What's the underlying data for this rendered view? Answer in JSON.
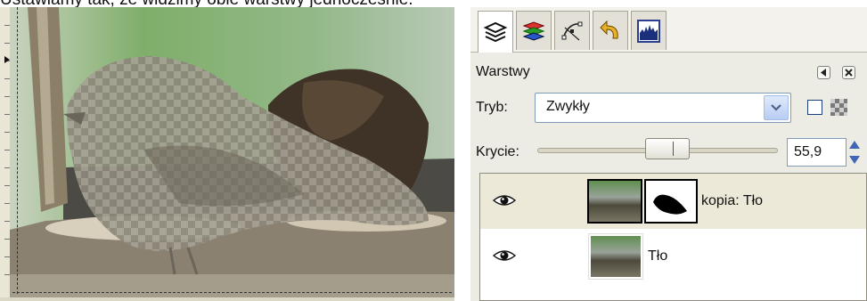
{
  "caption": "Ustawiamy tak, że widzimy obie warstwy jednocześnie.",
  "layers_dialog": {
    "title": "Warstwy",
    "tabs": [
      "layers-tab",
      "channels-tab",
      "paths-tab",
      "undo-history-tab",
      "histogram-tab"
    ],
    "mode_label": "Tryb:",
    "mode_value": "Zwykły",
    "opacity_label": "Krycie:",
    "opacity_value": "55,9",
    "opacity_level": 55.9,
    "layers": [
      {
        "name": "kopia: Tło",
        "visible": true,
        "has_mask": true
      },
      {
        "name": "Tło",
        "visible": true,
        "has_mask": false
      }
    ]
  },
  "colors": {
    "accent_blue": "#1f5fbf",
    "dock_bg": "#ecebe4",
    "selected_row": "#ece9d8"
  }
}
